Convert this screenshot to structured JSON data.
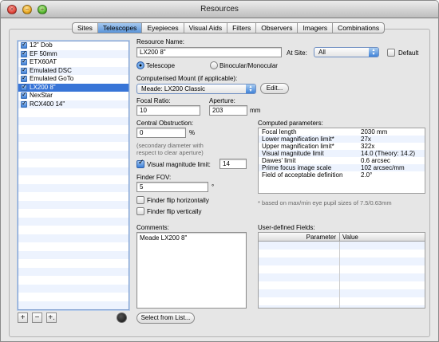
{
  "window": {
    "title": "Resources"
  },
  "tabs": [
    "Sites",
    "Telescopes",
    "Eyepieces",
    "Visual Aids",
    "Filters",
    "Observers",
    "Imagers",
    "Combinations"
  ],
  "active_tab": "Telescopes",
  "telescope_list": [
    {
      "name": "12\" Dob",
      "checked": true
    },
    {
      "name": "EF 50mm",
      "checked": true
    },
    {
      "name": "ETX60AT",
      "checked": true
    },
    {
      "name": "Emulated DSC",
      "checked": true
    },
    {
      "name": "Emulated GoTo",
      "checked": true
    },
    {
      "name": "LX200 8\"",
      "checked": true,
      "selected": true
    },
    {
      "name": "NexStar",
      "checked": true
    },
    {
      "name": "RCX400 14\"",
      "checked": true
    }
  ],
  "list_buttons": {
    "add": "+",
    "remove": "−",
    "add_special": "+."
  },
  "form": {
    "resource_name_label": "Resource Name:",
    "resource_name_value": "LX200 8\"",
    "at_site_label": "At Site:",
    "at_site_value": "All",
    "default_label": "Default",
    "type_telescope": "Telescope",
    "type_binocular": "Binocular/Monocular",
    "mount_label": "Computerised Mount (if applicable):",
    "mount_value": "Meade: LX200 Classic",
    "edit_button": "Edit...",
    "focal_ratio_label": "Focal Ratio:",
    "focal_ratio_value": "10",
    "aperture_label": "Aperture:",
    "aperture_value": "203",
    "aperture_unit": "mm",
    "central_obstruction_label": "Central Obstruction:",
    "central_obstruction_value": "0",
    "central_obstruction_unit": "%",
    "obstruction_note_1": "(secondary diameter with",
    "obstruction_note_2": "respect to clear aperture)",
    "vis_mag_label": "Visual magnitude limit:",
    "vis_mag_value": "14",
    "finder_fov_label": "Finder FOV:",
    "finder_fov_value": "5",
    "finder_fov_unit": "°",
    "flip_h_label": "Finder flip horizontally",
    "flip_v_label": "Finder flip vertically",
    "comments_label": "Comments:",
    "comments_value": "Meade LX200 8\"",
    "select_button": "Select from List..."
  },
  "computed": {
    "label": "Computed parameters:",
    "rows": [
      {
        "k": "Focal length",
        "v": "2030 mm"
      },
      {
        "k": "Lower magnification limit*",
        "v": "27x"
      },
      {
        "k": "Upper magnification limit*",
        "v": "322x"
      },
      {
        "k": "Visual magnitude limit",
        "v": "14.0 (Theory: 14.2)"
      },
      {
        "k": "Dawes' limit",
        "v": "0.6 arcsec"
      },
      {
        "k": "Prime focus image scale",
        "v": "102 arcsec/mm"
      },
      {
        "k": "Field of acceptable definition",
        "v": "2.0°"
      }
    ],
    "footnote": "* based on max/min eye pupil sizes of 7.5/0.63mm"
  },
  "user_fields": {
    "label": "User-defined Fields:",
    "col_parameter": "Parameter",
    "col_value": "Value"
  }
}
